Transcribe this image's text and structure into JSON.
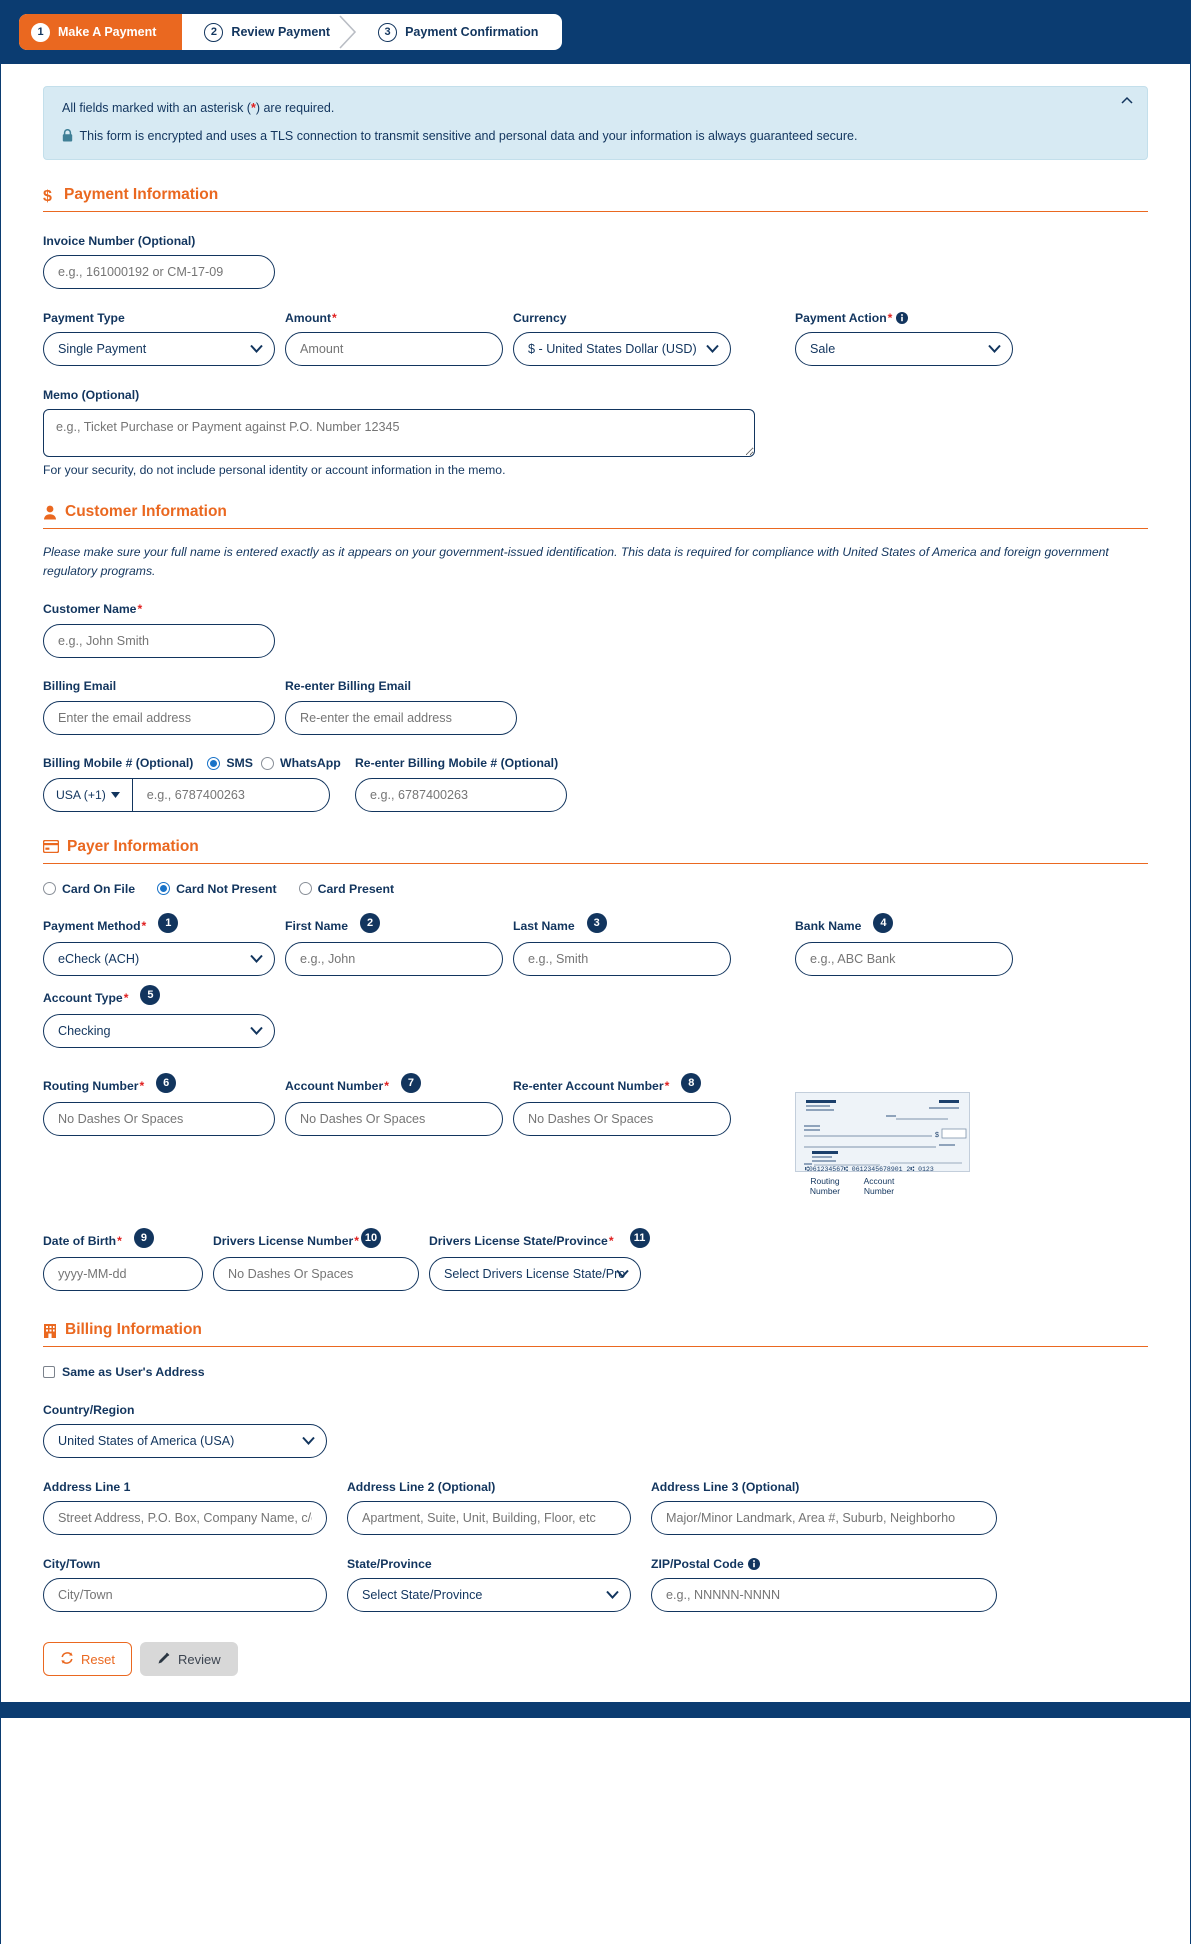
{
  "stepper": {
    "steps": [
      {
        "num": "1",
        "label": "Make A Payment"
      },
      {
        "num": "2",
        "label": "Review Payment"
      },
      {
        "num": "3",
        "label": "Payment Confirmation"
      }
    ]
  },
  "notice": {
    "line1_pre": "All fields marked with an asterisk (",
    "line1_star": "*",
    "line1_post": ") are required.",
    "line2": "This form is encrypted and uses a TLS connection to transmit sensitive and personal data and your information is always guaranteed secure."
  },
  "payment": {
    "title": "Payment Information",
    "invoice_label": "Invoice Number (Optional)",
    "invoice_placeholder": "e.g., 161000192 or CM-17-09",
    "type_label": "Payment Type",
    "type_value": "Single Payment",
    "amount_label": "Amount",
    "amount_placeholder": "Amount",
    "currency_label": "Currency",
    "currency_value": "$ - United States Dollar (USD)",
    "action_label": "Payment Action",
    "action_value": "Sale",
    "memo_label": "Memo (Optional)",
    "memo_placeholder": "e.g., Ticket Purchase or Payment against P.O. Number 12345",
    "memo_helper": "For your security, do not include personal identity or account information in the memo."
  },
  "customer": {
    "title": "Customer Information",
    "note": "Please make sure your full name is entered exactly as it appears on your government-issued identification. This data is required for compliance with United States of America and foreign government regulatory programs.",
    "name_label": "Customer Name",
    "name_placeholder": "e.g., John Smith",
    "email_label": "Billing Email",
    "email_placeholder": "Enter the email address",
    "email2_label": "Re-enter Billing Email",
    "email2_placeholder": "Re-enter the email address",
    "mobile_label": "Billing Mobile # (Optional)",
    "sms_label": "SMS",
    "whatsapp_label": "WhatsApp",
    "country_code": "USA (+1)",
    "mobile_placeholder": "e.g., 6787400263",
    "mobile2_label": "Re-enter Billing Mobile # (Optional)",
    "mobile2_placeholder": "e.g., 6787400263"
  },
  "payer": {
    "title": "Payer Information",
    "presence_options": [
      {
        "label": "Card On File",
        "selected": false
      },
      {
        "label": "Card Not Present",
        "selected": true
      },
      {
        "label": "Card Present",
        "selected": false
      }
    ],
    "method_label": "Payment Method",
    "method_badge": "1",
    "method_value": "eCheck (ACH)",
    "first_name_label": "First Name",
    "first_name_badge": "2",
    "first_name_placeholder": "e.g., John",
    "last_name_label": "Last Name",
    "last_name_badge": "3",
    "last_name_placeholder": "e.g., Smith",
    "bank_name_label": "Bank Name",
    "bank_name_badge": "4",
    "bank_name_placeholder": "e.g., ABC Bank",
    "account_type_label": "Account Type",
    "account_type_badge": "5",
    "account_type_value": "Checking",
    "routing_label": "Routing Number",
    "routing_badge": "6",
    "routing_placeholder": "No Dashes Or Spaces",
    "account_label": "Account Number",
    "account_badge": "7",
    "account_placeholder": "No Dashes Or Spaces",
    "account2_label": "Re-enter Account Number",
    "account2_badge": "8",
    "account2_placeholder": "No Dashes Or Spaces",
    "check_routing_caption": "Routing Number",
    "check_account_caption": "Account Number",
    "dob_label": "Date of Birth",
    "dob_badge": "9",
    "dob_placeholder": "yyyy-MM-dd",
    "dl_number_label": "Drivers License Number",
    "dl_number_badge": "10",
    "dl_number_placeholder": "No Dashes Or Spaces",
    "dl_state_label": "Drivers License State/Province",
    "dl_state_badge": "11",
    "dl_state_value": "Select Drivers License State/Pro"
  },
  "billing": {
    "title": "Billing Information",
    "same_as_user": "Same as User's Address",
    "country_label": "Country/Region",
    "country_value": "United States of America (USA)",
    "addr1_label": "Address Line 1",
    "addr1_placeholder": "Street Address, P.O. Box, Company Name, c/o",
    "addr2_label": "Address Line 2 (Optional)",
    "addr2_placeholder": "Apartment, Suite, Unit, Building, Floor, etc",
    "addr3_label": "Address Line 3 (Optional)",
    "addr3_placeholder": "Major/Minor Landmark, Area #, Suburb, Neighborho",
    "city_label": "City/Town",
    "city_placeholder": "City/Town",
    "state_label": "State/Province",
    "state_value": "Select State/Province",
    "zip_label": "ZIP/Postal Code",
    "zip_placeholder": "e.g., NNNNN-NNNN"
  },
  "actions": {
    "reset_label": "Reset",
    "review_label": "Review"
  },
  "colors": {
    "navy": "#0b3c71",
    "orange": "#ea6820",
    "notice_bg": "#d7eaf3",
    "required_red": "#e02020",
    "badge_navy": "#12355e"
  }
}
